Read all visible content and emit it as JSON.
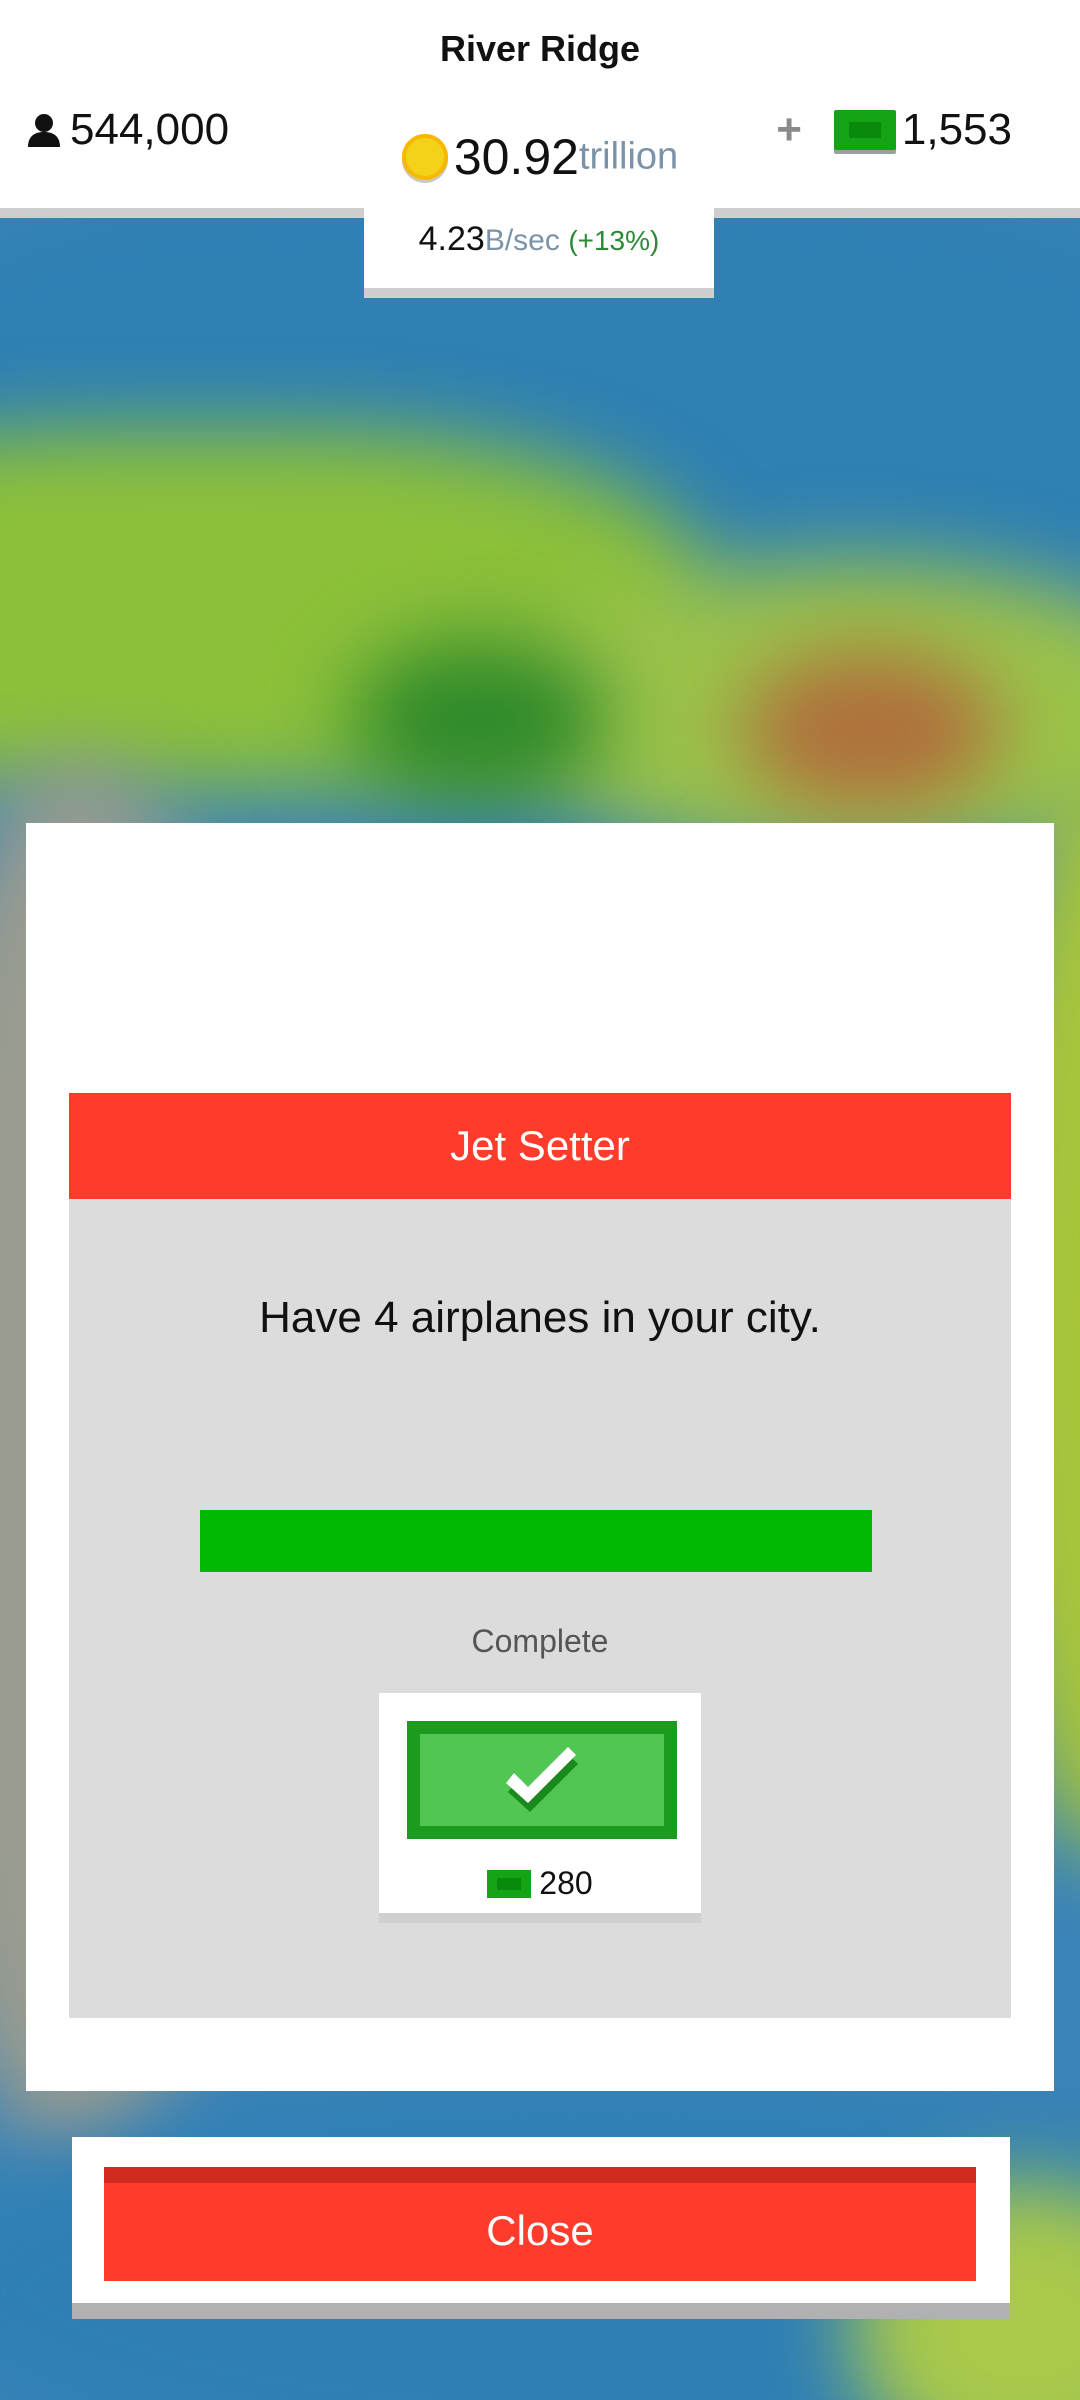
{
  "header": {
    "city_name": "River Ridge",
    "population": "544,000",
    "gems_plus": "+",
    "gems": "1,553",
    "money_amount": "30.92",
    "money_unit": "trillion",
    "rate_value": "4.23",
    "rate_unit": "B/sec",
    "rate_percent": "(+13%)"
  },
  "modal": {
    "title": "Jet Setter",
    "description": "Have 4 airplanes in your city.",
    "progress_fraction": 1.0,
    "progress_label": "Complete",
    "reward_amount": "280",
    "reward_icon": "check-icon"
  },
  "footer": {
    "close_label": "Close"
  },
  "colors": {
    "accent_red": "#ff3b2c",
    "progress_green": "#00b900",
    "gem_green": "#15a316"
  }
}
